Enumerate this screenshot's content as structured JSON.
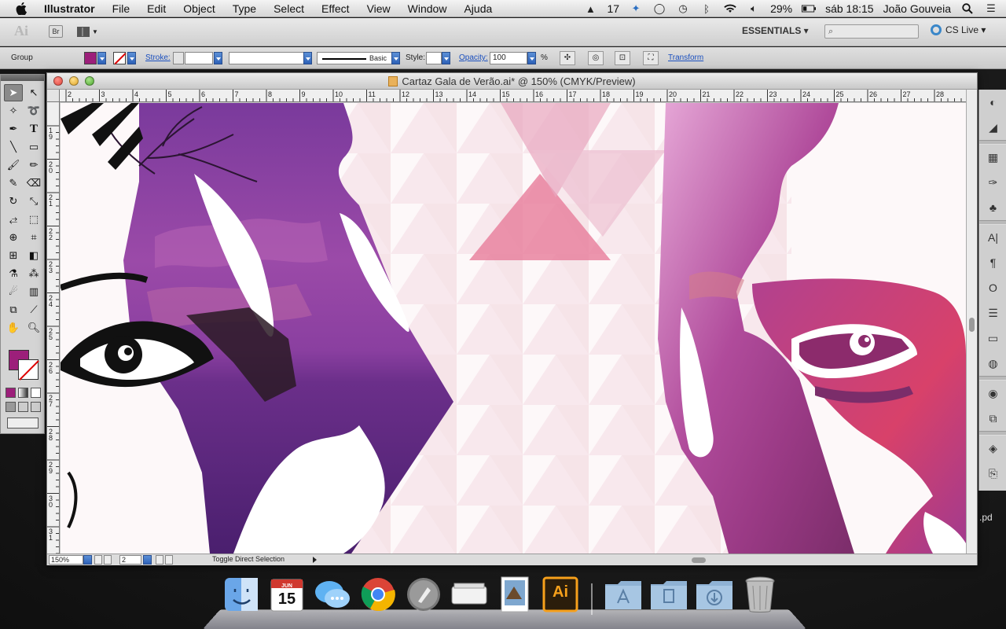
{
  "menubar": {
    "app_name": "Illustrator",
    "items": [
      "File",
      "Edit",
      "Object",
      "Type",
      "Select",
      "Effect",
      "View",
      "Window",
      "Ajuda"
    ],
    "status": {
      "adobe_count": "17",
      "battery": "29%",
      "clock": "sáb 18:15",
      "user": "João Gouveia"
    }
  },
  "appbar": {
    "br_label": "Br",
    "workspace": "ESSENTIALS ▾",
    "cs_live": "CS Live ▾"
  },
  "control": {
    "group_label": "Group",
    "fill_color": "#9c1f7a",
    "stroke_label": "Stroke:",
    "line_style": "Basic",
    "style_label": "Style:",
    "opacity_label": "Opacity:",
    "opacity_value": "100",
    "percent": "%",
    "transform_label": "Transform"
  },
  "document": {
    "title": "Cartaz Gala de Verão.ai* @ 150% (CMYK/Preview)",
    "ruler_top": [
      "2",
      "3",
      "4",
      "5",
      "6",
      "7",
      "8",
      "9",
      "10",
      "11",
      "12",
      "13",
      "14",
      "15",
      "16",
      "17",
      "18",
      "19",
      "20",
      "21",
      "22",
      "23",
      "24",
      "25",
      "26",
      "27",
      "28"
    ],
    "ruler_left": [
      "1 9",
      "2 0",
      "2 1",
      "2 2",
      "2 3",
      "2 4",
      "2 5",
      "2 6",
      "2 7",
      "2 8",
      "2 9",
      "3 0",
      "3 1"
    ]
  },
  "status": {
    "zoom": "150%",
    "artboard": "2",
    "message": "Toggle Direct Selection"
  },
  "side_label": ".pd",
  "dock": {
    "calendar_month": "JUN",
    "calendar_day": "15",
    "ai_label": "Ai"
  }
}
